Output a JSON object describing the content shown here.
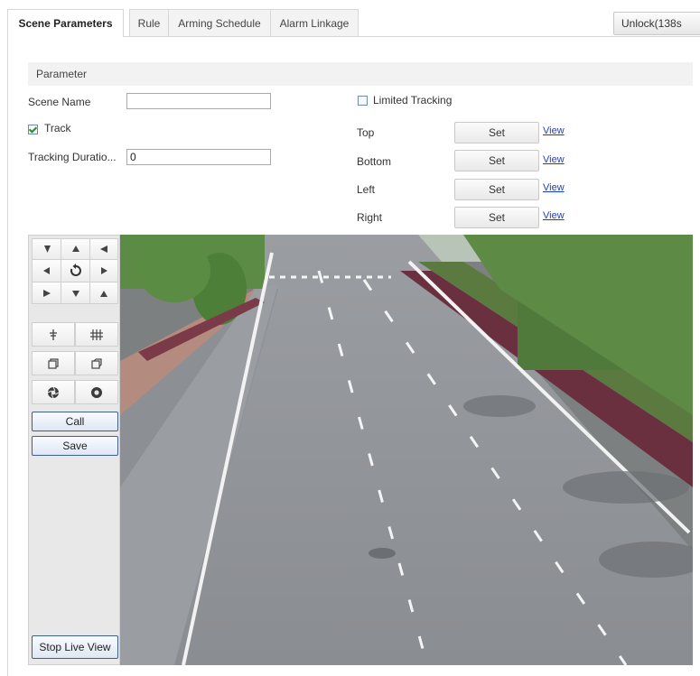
{
  "tabs": [
    {
      "label": "Scene Parameters",
      "active": true
    },
    {
      "label": "Rule",
      "active": false
    },
    {
      "label": "Arming Schedule",
      "active": false
    },
    {
      "label": "Alarm Linkage",
      "active": false
    }
  ],
  "unlock_label": "Unlock(138s",
  "parameter": {
    "section_title": "Parameter",
    "scene_name_label": "Scene Name",
    "scene_name_value": "",
    "track_label": "Track",
    "track_checked": true,
    "tracking_duration_label": "Tracking Duratio...",
    "tracking_duration_value": "0",
    "limited_tracking_label": "Limited Tracking",
    "limited_tracking_checked": false,
    "limits": [
      {
        "label": "Top",
        "set_label": "Set",
        "view_label": "View"
      },
      {
        "label": "Bottom",
        "set_label": "Set",
        "view_label": "View"
      },
      {
        "label": "Left",
        "set_label": "Set",
        "view_label": "View"
      },
      {
        "label": "Right",
        "set_label": "Set",
        "view_label": "View"
      }
    ]
  },
  "ptz": {
    "call_label": "Call",
    "save_label": "Save",
    "stop_live_view_label": "Stop Live View"
  }
}
